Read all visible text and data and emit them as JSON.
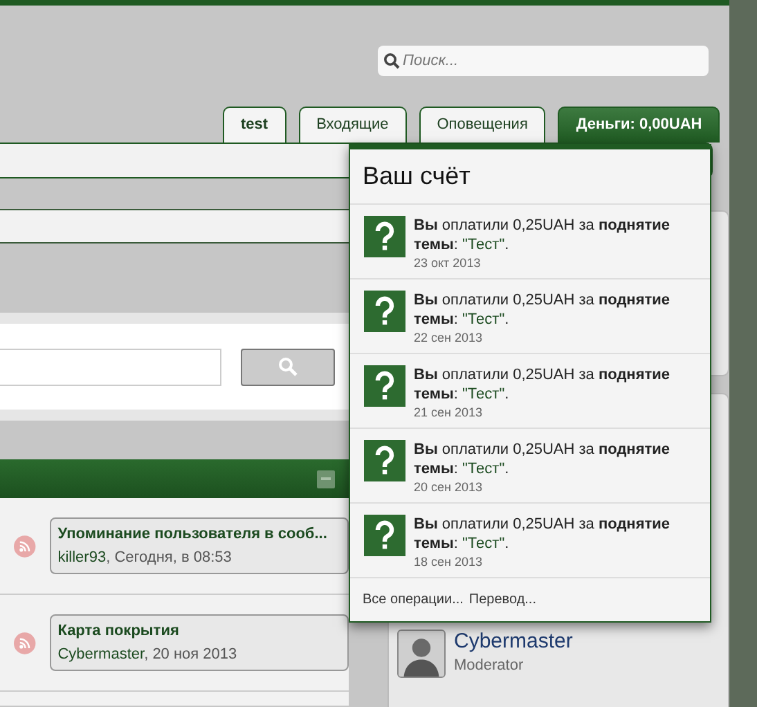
{
  "search": {
    "placeholder": "Поиск..."
  },
  "tabs": [
    {
      "label": "test",
      "selected": false,
      "kind": "user"
    },
    {
      "label": "Входящие",
      "selected": false,
      "kind": "plain"
    },
    {
      "label": "Оповещения",
      "selected": false,
      "kind": "plain"
    },
    {
      "label": "Деньги: 0,00UAH",
      "selected": true,
      "kind": "plain"
    }
  ],
  "account_popup": {
    "title": "Ваш счёт",
    "items": [
      {
        "text": "**Вы** оплатили 0,25UAH за **поднятие темы**:",
        "link": "\"Тест\"",
        "after": ".",
        "date": "23 окт 2013"
      },
      {
        "text": "**Вы** оплатили 0,25UAH за **поднятие темы**:",
        "link": "\"Тест\"",
        "after": ".",
        "date": "22 сен 2013"
      },
      {
        "text": "**Вы** оплатили 0,25UAH за **поднятие темы**:",
        "link": "\"Тест\"",
        "after": ".",
        "date": "21 сен 2013"
      },
      {
        "text": "**Вы** оплатили 0,25UAH за **поднятие темы**:",
        "link": "\"Тест\"",
        "after": ".",
        "date": "20 сен 2013"
      },
      {
        "text": "**Вы** оплатили 0,25UAH за **поднятие темы**:",
        "link": "\"Тест\"",
        "after": ".",
        "date": "18 сен 2013"
      }
    ],
    "footer_links": [
      "Все операции...",
      "Перевод..."
    ]
  },
  "threads": [
    {
      "title": "Упоминание пользователя в сооб...",
      "author": "killer93",
      "meta": ", Сегодня, в 08:53"
    },
    {
      "title": "Карта покрытия",
      "author": "Cybermaster",
      "meta": ", 20 ноя 2013"
    }
  ],
  "staff": [
    {
      "name": "Cybermaster",
      "role": "Moderator"
    }
  ]
}
